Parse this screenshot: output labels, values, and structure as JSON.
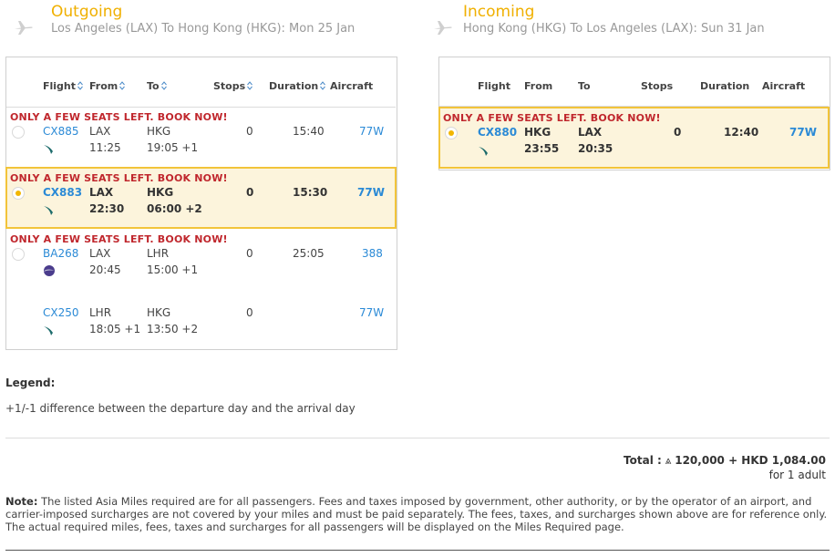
{
  "outgoing": {
    "title": "Outgoing",
    "route": "Los Angeles (LAX) To Hong Kong (HKG): Mon 25 Jan",
    "columns": {
      "flight": "Flight",
      "from": "From",
      "to": "To",
      "stops": "Stops",
      "duration": "Duration",
      "aircraft": "Aircraft"
    },
    "options": [
      {
        "warning": "ONLY A FEW SEATS LEFT. BOOK NOW!",
        "selected": false,
        "legs": [
          {
            "flight": "CX885",
            "airline_icon": "cathay-pacific-logo-icon",
            "from": "LAX",
            "dep": "11:25",
            "to": "HKG",
            "arr": "19:05 +1",
            "stops": "0",
            "duration": "15:40",
            "aircraft": "77W"
          }
        ]
      },
      {
        "warning": "ONLY A FEW SEATS LEFT. BOOK NOW!",
        "selected": true,
        "legs": [
          {
            "flight": "CX883",
            "airline_icon": "cathay-pacific-logo-icon",
            "from": "LAX",
            "dep": "22:30",
            "to": "HKG",
            "arr": "06:00 +2",
            "stops": "0",
            "duration": "15:30",
            "aircraft": "77W"
          }
        ]
      },
      {
        "warning": "ONLY A FEW SEATS LEFT. BOOK NOW!",
        "selected": false,
        "legs": [
          {
            "flight": "BA268",
            "airline_icon": "british-airways-logo-icon",
            "from": "LAX",
            "dep": "20:45",
            "to": "LHR",
            "arr": "15:00 +1",
            "stops": "0",
            "duration": "25:05",
            "aircraft": "388"
          },
          {
            "flight": "CX250",
            "airline_icon": "cathay-pacific-logo-icon",
            "from": "LHR",
            "dep": "18:05 +1",
            "to": "HKG",
            "arr": "13:50 +2",
            "stops": "0",
            "duration": "",
            "aircraft": "77W"
          }
        ]
      }
    ]
  },
  "incoming": {
    "title": "Incoming",
    "route": "Hong Kong (HKG) To Los Angeles (LAX): Sun 31 Jan",
    "columns": {
      "flight": "Flight",
      "from": "From",
      "to": "To",
      "stops": "Stops",
      "duration": "Duration",
      "aircraft": "Aircraft"
    },
    "options": [
      {
        "warning": "ONLY A FEW SEATS LEFT. BOOK NOW!",
        "selected": true,
        "legs": [
          {
            "flight": "CX880",
            "airline_icon": "cathay-pacific-logo-icon",
            "from": "HKG",
            "dep": "23:55",
            "to": "LAX",
            "arr": "20:35",
            "stops": "0",
            "duration": "12:40",
            "aircraft": "77W"
          }
        ]
      }
    ]
  },
  "legend": {
    "title": "Legend:",
    "text": "+1/-1 difference between the departure day and the arrival day"
  },
  "total": {
    "label": "Total :",
    "miles_symbol": "⩓",
    "amount": "120,000 + HKD 1,084.00",
    "passengers": "for 1 adult"
  },
  "note": {
    "label": "Note:",
    "text": "The listed Asia Miles required are for all passengers. Fees and taxes imposed by government, other authority, or by the operator of an airport, and carrier-imposed surcharges are not covered by your miles and must be paid separately. The fees, taxes, and surcharges shown above are for reference only. The actual required miles, fees, taxes and surcharges for all passengers will be displayed on the Miles Required page."
  },
  "colors": {
    "accent": "#f2c43a",
    "link": "#2b8ad6",
    "warning": "#c0272d",
    "selected_bg": "#fcf4dc"
  }
}
